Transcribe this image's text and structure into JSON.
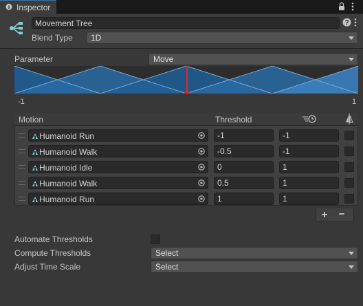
{
  "tab": {
    "title": "Inspector"
  },
  "header": {
    "name": "Movement Tree",
    "blend_type_label": "Blend Type",
    "blend_type_value": "1D"
  },
  "parameter": {
    "label": "Parameter",
    "value": "Move",
    "min_label": "-1",
    "max_label": "1",
    "marker_value": 0
  },
  "table": {
    "col_motion": "Motion",
    "col_threshold": "Threshold",
    "col_speed_icon": "speed-clock-icon",
    "col_mirror_icon": "mirror-icon",
    "rows": [
      {
        "motion": "Humanoid Run",
        "threshold": "-1",
        "speed": "-1",
        "mirror": false
      },
      {
        "motion": "Humanoid Walk",
        "threshold": "-0.5",
        "speed": "-1",
        "mirror": false
      },
      {
        "motion": "Humanoid Idle",
        "threshold": "0",
        "speed": "1",
        "mirror": false
      },
      {
        "motion": "Humanoid Walk",
        "threshold": "0.5",
        "speed": "1",
        "mirror": false
      },
      {
        "motion": "Humanoid Run",
        "threshold": "1",
        "speed": "1",
        "mirror": false
      }
    ],
    "add_label": "+",
    "remove_label": "−"
  },
  "bottom": {
    "automate_label": "Automate Thresholds",
    "automate_checked": false,
    "compute_label": "Compute Thresholds",
    "compute_value": "Select",
    "adjust_label": "Adjust Time Scale",
    "adjust_value": "Select"
  },
  "colors": {
    "graph_fill": "#1f5f98",
    "marker": "#e02828",
    "accent": "#3a72b0"
  }
}
